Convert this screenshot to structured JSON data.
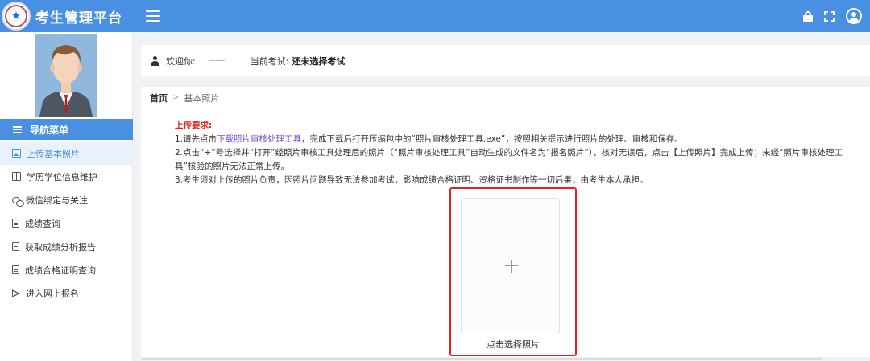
{
  "app": {
    "title": "考生管理平台"
  },
  "topbar": {
    "icons": [
      "lock-icon",
      "fullscreen-icon",
      "user-circle-icon"
    ]
  },
  "sidebar": {
    "nav_header": "导航菜单",
    "items": [
      {
        "label": "上传基本照片",
        "icon": "image-icon",
        "active": true
      },
      {
        "label": "学历学位信息维护",
        "icon": "book-icon",
        "active": false
      },
      {
        "label": "微信绑定与关注",
        "icon": "chat-icon",
        "active": false
      },
      {
        "label": "成绩查询",
        "icon": "document-icon",
        "active": false
      },
      {
        "label": "获取成绩分析报告",
        "icon": "document-icon",
        "active": false
      },
      {
        "label": "成绩合格证明查询",
        "icon": "document-icon",
        "active": false
      },
      {
        "label": "进入网上报名",
        "icon": "send-icon",
        "active": false
      }
    ]
  },
  "welcome": {
    "greeting": "欢迎你:",
    "exam_label": "当前考试:",
    "exam_value": "还未选择考试"
  },
  "breadcrumb": {
    "home": "首页",
    "current": "基本照片"
  },
  "requirements": {
    "title": "上传要求:",
    "line1_prefix": "1.请先点击",
    "line1_link": "下载照片审核处理工具",
    "line1_suffix": "，完成下载后打开压缩包中的“照片审核处理工具.exe”，按照相关提示进行照片的处理、审核和保存。",
    "line2": "2.点击“+”号选择并“打开”经照片审核工具处理后的照片（“照片审核处理工具”自动生成的文件名为“报名照片”），核对无误后，点击【上传照片】完成上传；未经“照片审核处理工具”核验的照片无法正常上传。",
    "line3": "3.考生须对上传的照片负责，因照片问题导致无法参加考试，影响成绩合格证明、资格证书制作等一切后果，由考生本人承担。"
  },
  "upload": {
    "caption": "点击选择照片"
  },
  "colors": {
    "primary": "#4a90e2",
    "highlight": "#e8201a",
    "warning_text": "#e0251f",
    "link": "#7a4fd1"
  }
}
